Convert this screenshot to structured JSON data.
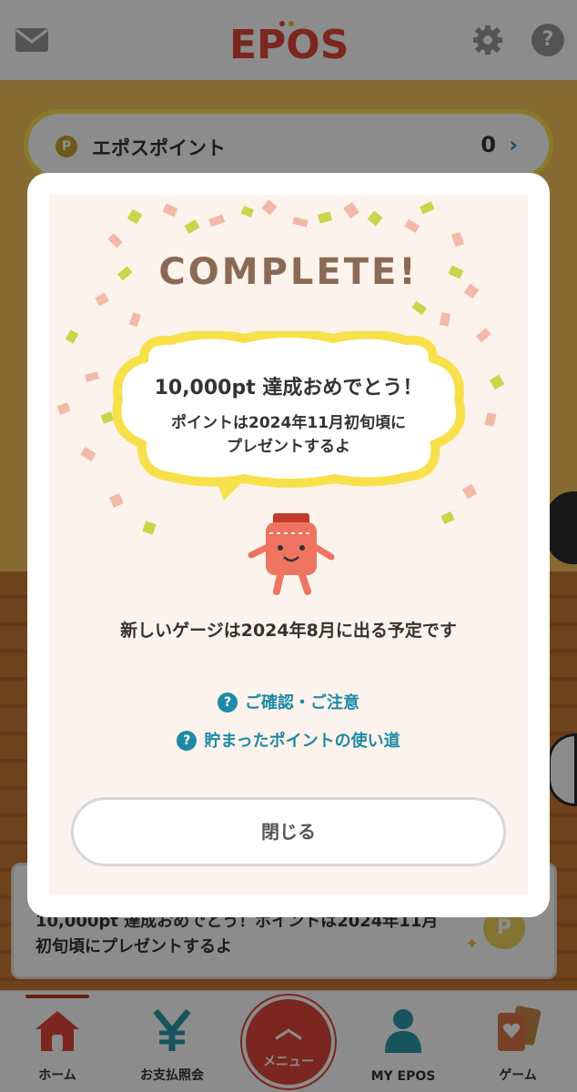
{
  "header": {
    "logo_text": "EPOS",
    "mail_icon": "mail-icon",
    "settings_icon": "gear-icon",
    "help_label": "?"
  },
  "points": {
    "coin_label": "P",
    "label": "エポスポイント",
    "value": "0",
    "arrow": "›"
  },
  "notice": {
    "text": "10,000pt 達成おめでとう！ポイントは2024年11月初旬頃にプレゼントするよ",
    "coin_label": "P",
    "sparkle": "✦"
  },
  "modal": {
    "title": "COMPLETE!",
    "bubble_title": "10,000pt 達成おめでとう！",
    "bubble_line1": "ポイントは2024年11月初旬頃に",
    "bubble_line2": "プレゼントするよ",
    "gauge_text": "新しいゲージは2024年8月に出る予定です",
    "link_icon": "?",
    "link1": "ご確認・ご注意",
    "link2": "貯まったポイントの使い道",
    "close_label": "閉じる"
  },
  "tabs": [
    {
      "label": "ホーム",
      "icon": "home-icon"
    },
    {
      "label": "お支払照会",
      "icon": "yen-icon"
    },
    {
      "label": "メニュー",
      "icon": "chevron-up-icon"
    },
    {
      "label": "MY EPOS",
      "icon": "person-icon"
    },
    {
      "label": "ゲーム",
      "icon": "cards-icon"
    }
  ],
  "colors": {
    "accent_red": "#e0473a",
    "link_teal": "#1e8aa6",
    "bubble_yellow": "#f7e04a",
    "title_brown": "#8a6a55"
  }
}
